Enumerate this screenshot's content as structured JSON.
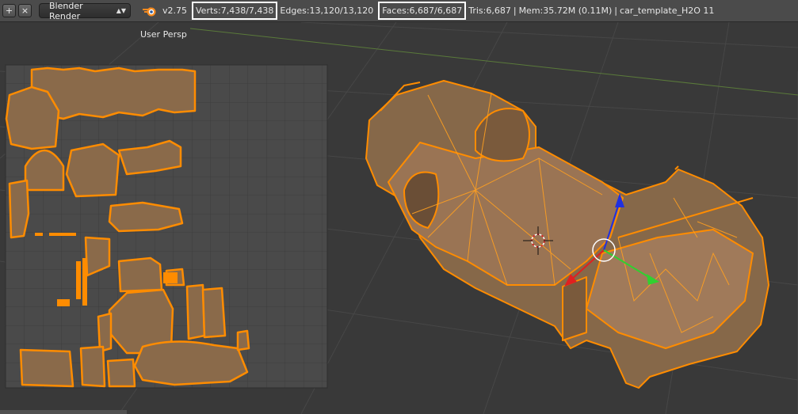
{
  "header": {
    "add_icon": "plus-icon",
    "close_icon": "close-icon",
    "render_engine": "Blender Render",
    "logo_icon": "blender-logo-icon",
    "version": "v2.75",
    "verts": "Verts:7,438/7,438",
    "edges": "Edges:13,120/13,120",
    "faces": "Faces:6,687/6,687",
    "tris": "Tris:6,687",
    "mem": "Mem:35.72M (0.11M)",
    "file": "car_template_H2O 11",
    "separator": "|"
  },
  "viewport": {
    "view_label": "User Persp"
  },
  "colors": {
    "mesh_edge": "#ff8c00",
    "mesh_face": "#8a6a4a",
    "background": "#393939",
    "x_axis": "#e02020",
    "y_axis": "#30d030",
    "z_axis": "#2030e0"
  }
}
